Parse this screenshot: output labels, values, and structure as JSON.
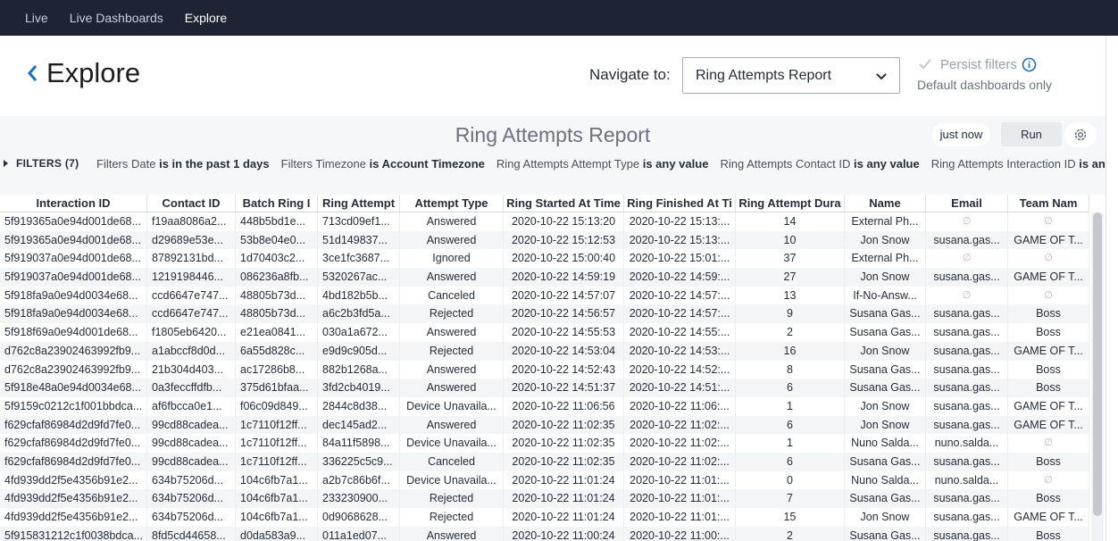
{
  "topnav": {
    "items": [
      "Live",
      "Live Dashboards",
      "Explore"
    ],
    "active": 2
  },
  "header": {
    "title": "Explore",
    "navigate_label": "Navigate to:",
    "navigate_value": "Ring Attempts Report",
    "persist_label": "Persist filters",
    "default_only": "Default dashboards only"
  },
  "dashboard": {
    "title": "Ring Attempts Report",
    "just_now": "just now",
    "run": "Run",
    "filters_label": "FILTERS (7)",
    "filters": [
      {
        "field": "Filters Date",
        "op": "is in the past 1 days"
      },
      {
        "field": "Filters Timezone",
        "op": "is Account Timezone"
      },
      {
        "field": "Ring Attempts Attempt Type",
        "op": "is any value"
      },
      {
        "field": "Ring Attempts Contact ID",
        "op": "is any value"
      },
      {
        "field": "Ring Attempts Interaction ID",
        "op": "is any value"
      }
    ]
  },
  "table": {
    "columns": [
      "Interaction ID",
      "Contact ID",
      "Batch Ring I",
      "Ring Attempt",
      "Attempt Type",
      "Ring Started At Time",
      "Ring Finished At Ti",
      "Ring Attempt Dura",
      "Name",
      "Email",
      "Team Nam"
    ],
    "rows": [
      [
        "5f919365a0e94d001de68...",
        "f19aa8086a2...",
        "448b5bd1e...",
        "713cd09ef1...",
        "Answered",
        "2020-10-22 15:13:20",
        "2020-10-22 15:13:...",
        "14",
        "External Ph...",
        "∅",
        "∅"
      ],
      [
        "5f919365a0e94d001de68...",
        "d29689e53e...",
        "53b8e04e0...",
        "51d149837...",
        "Answered",
        "2020-10-22 15:12:53",
        "2020-10-22 15:13:...",
        "10",
        "Jon Snow",
        "susana.gas...",
        "GAME OF T..."
      ],
      [
        "5f919037a0e94d001de68...",
        "87892131bd...",
        "1d70403c2...",
        "3ce1fc3687...",
        "Ignored",
        "2020-10-22 15:00:40",
        "2020-10-22 15:01:...",
        "37",
        "External Ph...",
        "∅",
        "∅"
      ],
      [
        "5f919037a0e94d001de68...",
        "1219198446...",
        "086236a8fb...",
        "5320267ac...",
        "Answered",
        "2020-10-22 14:59:19",
        "2020-10-22 14:59:...",
        "27",
        "Jon Snow",
        "susana.gas...",
        "GAME OF T..."
      ],
      [
        "5f918fa9a0e94d0034e68...",
        "ccd6647e747...",
        "48805b73d...",
        "4bd182b5b...",
        "Canceled",
        "2020-10-22 14:57:07",
        "2020-10-22 14:57:...",
        "13",
        "If-No-Answ...",
        "∅",
        "∅"
      ],
      [
        "5f918fa9a0e94d0034e68...",
        "ccd6647e747...",
        "48805b73d...",
        "a6c2b3fd5a...",
        "Rejected",
        "2020-10-22 14:56:57",
        "2020-10-22 14:57:...",
        "9",
        "Susana Gas...",
        "susana.gas...",
        "Boss"
      ],
      [
        "5f918f69a0e94d001de68...",
        "f1805eb6420...",
        "e21ea0841...",
        "030a1a672...",
        "Answered",
        "2020-10-22 14:55:53",
        "2020-10-22 14:55:...",
        "2",
        "Susana Gas...",
        "susana.gas...",
        "Boss"
      ],
      [
        "d762c8a23902463992fb9...",
        "a1abccf8d0d...",
        "6a55d828c...",
        "e9d9c905d...",
        "Rejected",
        "2020-10-22 14:53:04",
        "2020-10-22 14:53:...",
        "16",
        "Jon Snow",
        "susana.gas...",
        "GAME OF T..."
      ],
      [
        "d762c8a23902463992fb9...",
        "21b304d403...",
        "ac17286b8...",
        "882b1268a...",
        "Answered",
        "2020-10-22 14:52:43",
        "2020-10-22 14:52:...",
        "8",
        "Susana Gas...",
        "susana.gas...",
        "Boss"
      ],
      [
        "5f918e48a0e94d0034e68...",
        "0a3feccffdfb...",
        "375d61bfaa...",
        "3fd2cb4019...",
        "Answered",
        "2020-10-22 14:51:37",
        "2020-10-22 14:51:...",
        "6",
        "Susana Gas...",
        "susana.gas...",
        "Boss"
      ],
      [
        "5f9159c0212c1f001bbdca...",
        "af6fbcca0e1...",
        "f06c09d849...",
        "2844c8d38...",
        "Device Unavaila...",
        "2020-10-22 11:06:56",
        "2020-10-22 11:06:...",
        "1",
        "Jon Snow",
        "susana.gas...",
        "GAME OF T..."
      ],
      [
        "f629cfaf86984d2d9fd7fe0...",
        "99cd88cadea...",
        "1c7110f12ff...",
        "dec145ad2...",
        "Answered",
        "2020-10-22 11:02:35",
        "2020-10-22 11:02:...",
        "6",
        "Jon Snow",
        "susana.gas...",
        "GAME OF T..."
      ],
      [
        "f629cfaf86984d2d9fd7fe0...",
        "99cd88cadea...",
        "1c7110f12ff...",
        "84a11f5898...",
        "Device Unavaila...",
        "2020-10-22 11:02:35",
        "2020-10-22 11:02:...",
        "1",
        "Nuno Salda...",
        "nuno.salda...",
        "∅"
      ],
      [
        "f629cfaf86984d2d9fd7fe0...",
        "99cd88cadea...",
        "1c7110f12ff...",
        "336225c5c9...",
        "Canceled",
        "2020-10-22 11:02:35",
        "2020-10-22 11:02:...",
        "6",
        "Susana Gas...",
        "susana.gas...",
        "Boss"
      ],
      [
        "4fd939dd2f5e4356b91e2...",
        "634b75206d...",
        "104c6fb7a1...",
        "a2b7c86b6f...",
        "Device Unavaila...",
        "2020-10-22 11:01:24",
        "2020-10-22 11:01:...",
        "0",
        "Nuno Salda...",
        "nuno.salda...",
        "∅"
      ],
      [
        "4fd939dd2f5e4356b91e2...",
        "634b75206d...",
        "104c6fb7a1...",
        "233230900...",
        "Rejected",
        "2020-10-22 11:01:24",
        "2020-10-22 11:01:...",
        "7",
        "Susana Gas...",
        "susana.gas...",
        "Boss"
      ],
      [
        "4fd939dd2f5e4356b91e2...",
        "634b75206d...",
        "104c6fb7a1...",
        "0d9068628...",
        "Rejected",
        "2020-10-22 11:01:24",
        "2020-10-22 11:01:...",
        "15",
        "Jon Snow",
        "susana.gas...",
        "GAME OF T..."
      ],
      [
        "5f915831212c1f0038bdca...",
        "8fd5cd44658...",
        "d0da583a9...",
        "011a1ed07...",
        "Answered",
        "2020-10-22 11:00:24",
        "2020-10-22 11:00:...",
        "2",
        "Susana Gas...",
        "susana.gas...",
        "Boss"
      ]
    ]
  }
}
